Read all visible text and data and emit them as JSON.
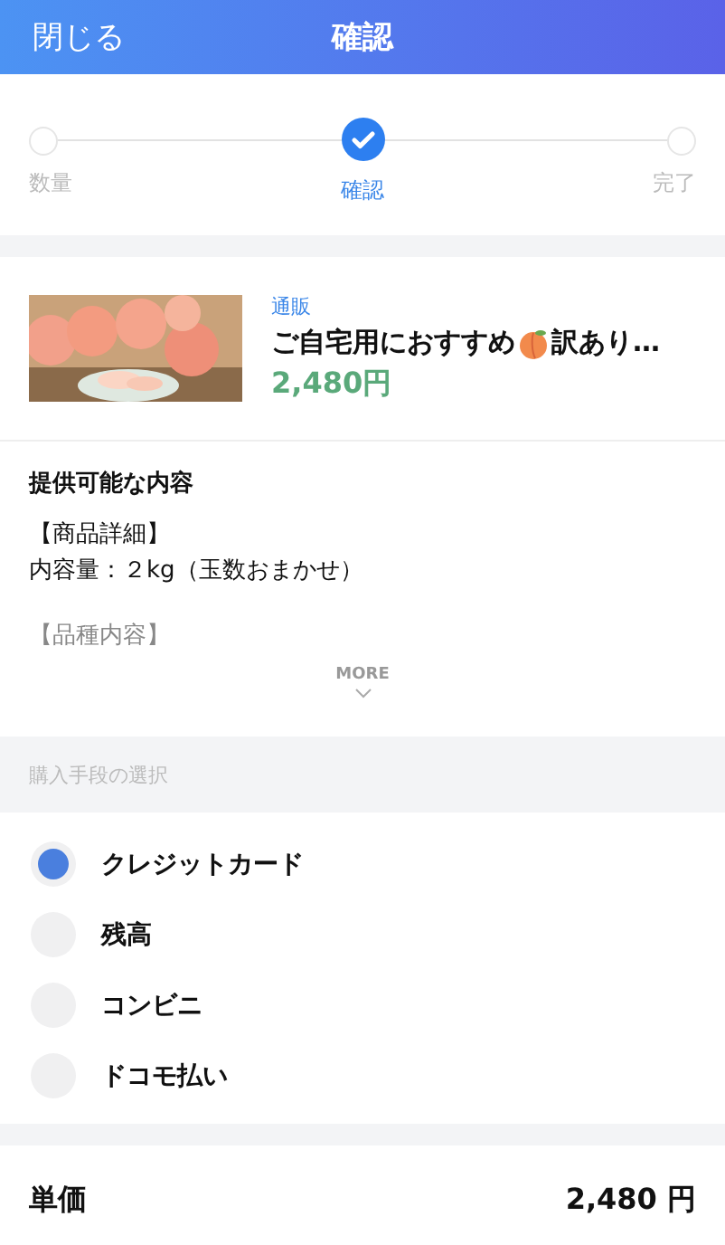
{
  "header": {
    "close": "閉じる",
    "title": "確認"
  },
  "steps": [
    {
      "label": "数量",
      "selected": false
    },
    {
      "label": "確認",
      "selected": true
    },
    {
      "label": "完了",
      "selected": false
    }
  ],
  "product": {
    "category": "通販",
    "title_before": "ご自宅用におすすめ",
    "title_after": "訳あり…",
    "price": "2,480円"
  },
  "description": {
    "heading": "提供可能な内容",
    "lines": [
      "【商品詳細】",
      "内容量：２kg（玉数おまかせ）",
      "【品種内容】"
    ],
    "more": "MORE"
  },
  "payment": {
    "heading": "購入手段の選択",
    "options": [
      {
        "label": "クレジットカード",
        "selected": true
      },
      {
        "label": "残高",
        "selected": false
      },
      {
        "label": "コンビニ",
        "selected": false
      },
      {
        "label": "ドコモ払い",
        "selected": false
      }
    ]
  },
  "summary": {
    "label": "単価",
    "value": "2,480 円"
  }
}
